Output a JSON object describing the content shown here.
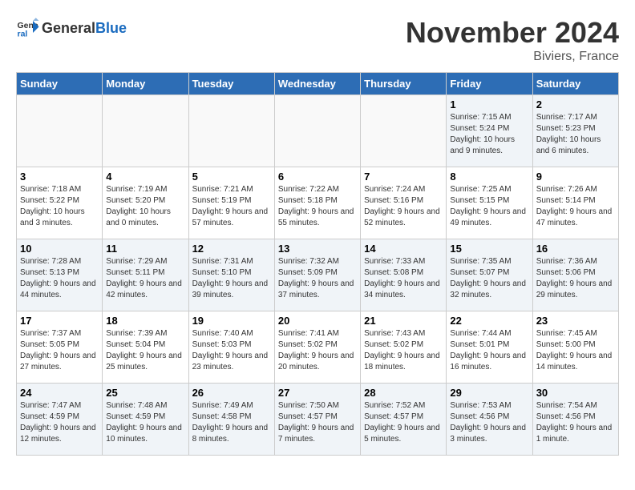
{
  "header": {
    "logo_general": "General",
    "logo_blue": "Blue",
    "month": "November 2024",
    "location": "Biviers, France"
  },
  "weekdays": [
    "Sunday",
    "Monday",
    "Tuesday",
    "Wednesday",
    "Thursday",
    "Friday",
    "Saturday"
  ],
  "weeks": [
    [
      {
        "day": "",
        "info": ""
      },
      {
        "day": "",
        "info": ""
      },
      {
        "day": "",
        "info": ""
      },
      {
        "day": "",
        "info": ""
      },
      {
        "day": "",
        "info": ""
      },
      {
        "day": "1",
        "info": "Sunrise: 7:15 AM\nSunset: 5:24 PM\nDaylight: 10 hours and 9 minutes."
      },
      {
        "day": "2",
        "info": "Sunrise: 7:17 AM\nSunset: 5:23 PM\nDaylight: 10 hours and 6 minutes."
      }
    ],
    [
      {
        "day": "3",
        "info": "Sunrise: 7:18 AM\nSunset: 5:22 PM\nDaylight: 10 hours and 3 minutes."
      },
      {
        "day": "4",
        "info": "Sunrise: 7:19 AM\nSunset: 5:20 PM\nDaylight: 10 hours and 0 minutes."
      },
      {
        "day": "5",
        "info": "Sunrise: 7:21 AM\nSunset: 5:19 PM\nDaylight: 9 hours and 57 minutes."
      },
      {
        "day": "6",
        "info": "Sunrise: 7:22 AM\nSunset: 5:18 PM\nDaylight: 9 hours and 55 minutes."
      },
      {
        "day": "7",
        "info": "Sunrise: 7:24 AM\nSunset: 5:16 PM\nDaylight: 9 hours and 52 minutes."
      },
      {
        "day": "8",
        "info": "Sunrise: 7:25 AM\nSunset: 5:15 PM\nDaylight: 9 hours and 49 minutes."
      },
      {
        "day": "9",
        "info": "Sunrise: 7:26 AM\nSunset: 5:14 PM\nDaylight: 9 hours and 47 minutes."
      }
    ],
    [
      {
        "day": "10",
        "info": "Sunrise: 7:28 AM\nSunset: 5:13 PM\nDaylight: 9 hours and 44 minutes."
      },
      {
        "day": "11",
        "info": "Sunrise: 7:29 AM\nSunset: 5:11 PM\nDaylight: 9 hours and 42 minutes."
      },
      {
        "day": "12",
        "info": "Sunrise: 7:31 AM\nSunset: 5:10 PM\nDaylight: 9 hours and 39 minutes."
      },
      {
        "day": "13",
        "info": "Sunrise: 7:32 AM\nSunset: 5:09 PM\nDaylight: 9 hours and 37 minutes."
      },
      {
        "day": "14",
        "info": "Sunrise: 7:33 AM\nSunset: 5:08 PM\nDaylight: 9 hours and 34 minutes."
      },
      {
        "day": "15",
        "info": "Sunrise: 7:35 AM\nSunset: 5:07 PM\nDaylight: 9 hours and 32 minutes."
      },
      {
        "day": "16",
        "info": "Sunrise: 7:36 AM\nSunset: 5:06 PM\nDaylight: 9 hours and 29 minutes."
      }
    ],
    [
      {
        "day": "17",
        "info": "Sunrise: 7:37 AM\nSunset: 5:05 PM\nDaylight: 9 hours and 27 minutes."
      },
      {
        "day": "18",
        "info": "Sunrise: 7:39 AM\nSunset: 5:04 PM\nDaylight: 9 hours and 25 minutes."
      },
      {
        "day": "19",
        "info": "Sunrise: 7:40 AM\nSunset: 5:03 PM\nDaylight: 9 hours and 23 minutes."
      },
      {
        "day": "20",
        "info": "Sunrise: 7:41 AM\nSunset: 5:02 PM\nDaylight: 9 hours and 20 minutes."
      },
      {
        "day": "21",
        "info": "Sunrise: 7:43 AM\nSunset: 5:02 PM\nDaylight: 9 hours and 18 minutes."
      },
      {
        "day": "22",
        "info": "Sunrise: 7:44 AM\nSunset: 5:01 PM\nDaylight: 9 hours and 16 minutes."
      },
      {
        "day": "23",
        "info": "Sunrise: 7:45 AM\nSunset: 5:00 PM\nDaylight: 9 hours and 14 minutes."
      }
    ],
    [
      {
        "day": "24",
        "info": "Sunrise: 7:47 AM\nSunset: 4:59 PM\nDaylight: 9 hours and 12 minutes."
      },
      {
        "day": "25",
        "info": "Sunrise: 7:48 AM\nSunset: 4:59 PM\nDaylight: 9 hours and 10 minutes."
      },
      {
        "day": "26",
        "info": "Sunrise: 7:49 AM\nSunset: 4:58 PM\nDaylight: 9 hours and 8 minutes."
      },
      {
        "day": "27",
        "info": "Sunrise: 7:50 AM\nSunset: 4:57 PM\nDaylight: 9 hours and 7 minutes."
      },
      {
        "day": "28",
        "info": "Sunrise: 7:52 AM\nSunset: 4:57 PM\nDaylight: 9 hours and 5 minutes."
      },
      {
        "day": "29",
        "info": "Sunrise: 7:53 AM\nSunset: 4:56 PM\nDaylight: 9 hours and 3 minutes."
      },
      {
        "day": "30",
        "info": "Sunrise: 7:54 AM\nSunset: 4:56 PM\nDaylight: 9 hours and 1 minute."
      }
    ]
  ]
}
